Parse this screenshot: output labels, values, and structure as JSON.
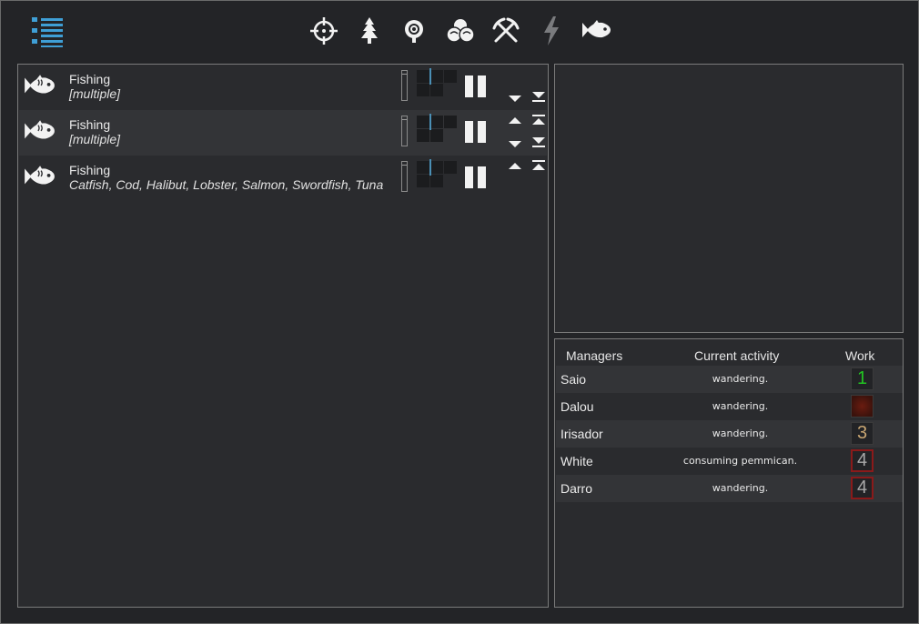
{
  "toolbar": {
    "menu_icon": "list-menu-icon",
    "tabs": [
      {
        "icon": "crosshair-icon"
      },
      {
        "icon": "tree-icon"
      },
      {
        "icon": "berry-bush-icon"
      },
      {
        "icon": "nuts-icon"
      },
      {
        "icon": "crossed-pickaxes-icon"
      },
      {
        "icon": "lightning-icon"
      },
      {
        "icon": "fish-icon"
      }
    ]
  },
  "jobs": [
    {
      "title": "Fishing",
      "subtitle": "[multiple]",
      "icon": "fish-icon"
    },
    {
      "title": "Fishing",
      "subtitle": "[multiple]",
      "icon": "fish-icon"
    },
    {
      "title": "Fishing",
      "subtitle": "Catfish, Cod, Halibut, Lobster, Salmon, Swordfish, Tuna",
      "icon": "fish-icon"
    }
  ],
  "managers_panel": {
    "headers": {
      "managers": "Managers",
      "activity": "Current activity",
      "work": "Work"
    },
    "rows": [
      {
        "name": "Saio",
        "activity": "wandering.",
        "work": "1",
        "work_color": "#22c322",
        "border": "normal"
      },
      {
        "name": "Dalou",
        "activity": "wandering.",
        "work": "",
        "work_color": "#5a1a10",
        "border": "normal"
      },
      {
        "name": "Irisador",
        "activity": "wandering.",
        "work": "3",
        "work_color": "#c8a572",
        "border": "normal"
      },
      {
        "name": "White",
        "activity": "consuming pemmican.",
        "work": "4",
        "work_color": "#a8a8a8",
        "border": "red"
      },
      {
        "name": "Darro",
        "activity": "wandering.",
        "work": "4",
        "work_color": "#a8a8a8",
        "border": "red"
      }
    ]
  },
  "colors": {
    "accent_blue": "#3f9fd6",
    "panel_bg": "#2a2b2e",
    "row_alt": "#333437",
    "danger_border": "#8a1a1a"
  }
}
